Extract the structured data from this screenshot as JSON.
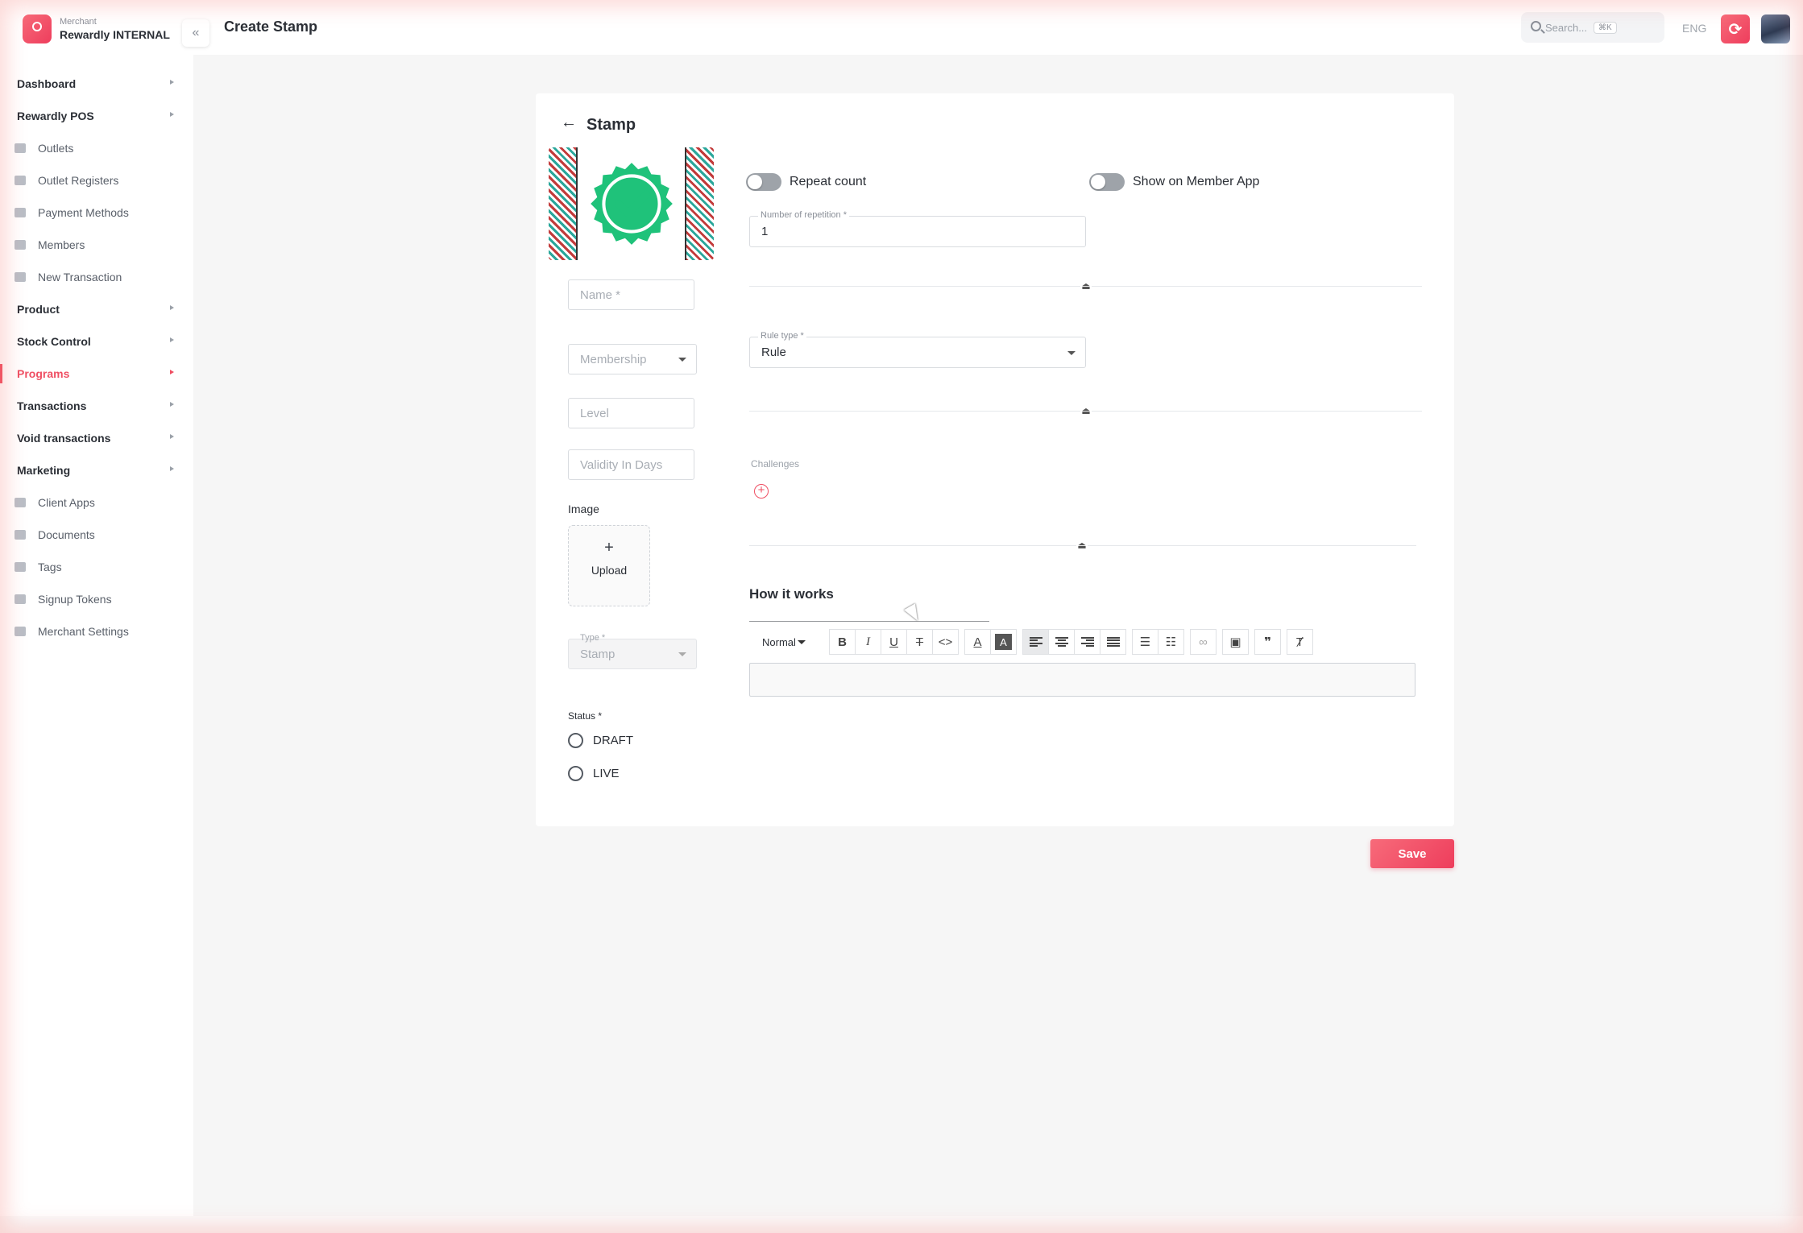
{
  "brand": {
    "subtitle": "Merchant",
    "name": "Rewardly INTERNAL"
  },
  "header": {
    "title": "Create Stamp",
    "search_placeholder": "Search...",
    "search_shortcut": "⌘K",
    "language": "ENG"
  },
  "sidebar": {
    "items": [
      {
        "label": "Dashboard",
        "kind": "section",
        "icon": "none"
      },
      {
        "label": "Rewardly POS",
        "kind": "section",
        "icon": "none"
      },
      {
        "label": "Outlets",
        "kind": "sub",
        "icon": "store-icon"
      },
      {
        "label": "Outlet Registers",
        "kind": "sub",
        "icon": "register-icon"
      },
      {
        "label": "Payment Methods",
        "kind": "sub",
        "icon": "payment-icon"
      },
      {
        "label": "Members",
        "kind": "sub",
        "icon": "user-icon"
      },
      {
        "label": "New Transaction",
        "kind": "sub",
        "icon": "card-icon"
      },
      {
        "label": "Product",
        "kind": "section",
        "icon": "none"
      },
      {
        "label": "Stock Control",
        "kind": "section",
        "icon": "none"
      },
      {
        "label": "Programs",
        "kind": "section",
        "icon": "none",
        "active": true
      },
      {
        "label": "Transactions",
        "kind": "section",
        "icon": "none"
      },
      {
        "label": "Void transactions",
        "kind": "section",
        "icon": "none"
      },
      {
        "label": "Marketing",
        "kind": "section",
        "icon": "none"
      },
      {
        "label": "Client Apps",
        "kind": "sub",
        "icon": "code-icon"
      },
      {
        "label": "Documents",
        "kind": "sub",
        "icon": "document-icon"
      },
      {
        "label": "Tags",
        "kind": "sub",
        "icon": "tag-icon"
      },
      {
        "label": "Signup Tokens",
        "kind": "sub",
        "icon": "token-icon"
      },
      {
        "label": "Merchant Settings",
        "kind": "sub",
        "icon": "settings-icon"
      }
    ]
  },
  "form": {
    "title": "Stamp",
    "name_placeholder": "Name *",
    "membership_placeholder": "Membership",
    "level_placeholder": "Level",
    "validity_placeholder": "Validity In Days",
    "image_label": "Image",
    "upload_plus": "+",
    "upload_label": "Upload",
    "type_label": "Type *",
    "type_value": "Stamp",
    "status_label": "Status *",
    "status_options": [
      "DRAFT",
      "LIVE"
    ],
    "repeat_count_label": "Repeat count",
    "show_member_app_label": "Show on Member App",
    "repetition_label": "Number of repetition *",
    "repetition_value": "1",
    "rule_type_label": "Rule type *",
    "rule_type_value": "Rule",
    "challenges_label": "Challenges",
    "add_challenge": "+",
    "how_it_works_title": "How it works",
    "editor_format": "Normal",
    "save_label": "Save"
  },
  "colors": {
    "accent": "#ef4f63",
    "stamp_green": "#1fc27a"
  }
}
